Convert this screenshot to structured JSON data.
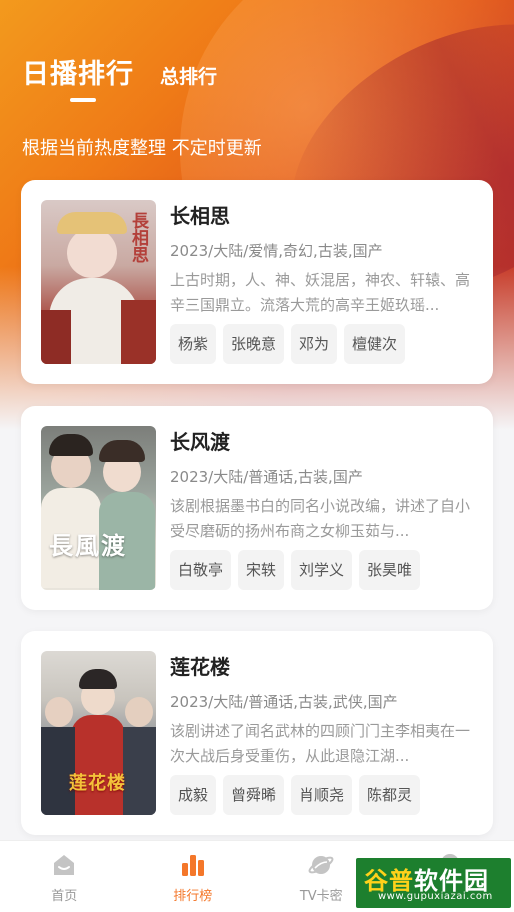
{
  "header": {
    "tab_daily": "日播排行",
    "tab_total": "总排行",
    "subtitle": "根据当前热度整理 不定时更新"
  },
  "shows": [
    {
      "title": "长相思",
      "meta": "2023/大陆/爱情,奇幻,古装,国产",
      "desc": "上古时期，人、神、妖混居，神农、轩辕、高辛三国鼎立。流落大荒的高辛王姬玖瑶...",
      "cast": [
        "杨紫",
        "张晚意",
        "邓为",
        "檀健次"
      ],
      "poster_text": "長相思"
    },
    {
      "title": "长风渡",
      "meta": "2023/大陆/普通话,古装,国产",
      "desc": "该剧根据墨书白的同名小说改编，讲述了自小受尽磨砺的扬州布商之女柳玉茹与...",
      "cast": [
        "白敬亭",
        "宋轶",
        "刘学义",
        "张昊唯"
      ],
      "poster_text": "長風渡"
    },
    {
      "title": "莲花楼",
      "meta": "2023/大陆/普通话,古装,武侠,国产",
      "desc": "该剧讲述了闻名武林的四顾门门主李相夷在一次大战后身受重伤，从此退隐江湖...",
      "cast": [
        "成毅",
        "曾舜晞",
        "肖顺尧",
        "陈都灵"
      ],
      "poster_text": "莲花楼"
    }
  ],
  "nav": {
    "home": "首页",
    "ranking": "排行榜",
    "tvcard": "TV卡密"
  },
  "watermark": {
    "brand_a": "谷普",
    "brand_b": "软件园",
    "url": "www.gupuxiazai.com"
  },
  "colors": {
    "accent": "#f4772a",
    "hero_start": "#f39a1d",
    "hero_end": "#c7392a"
  }
}
